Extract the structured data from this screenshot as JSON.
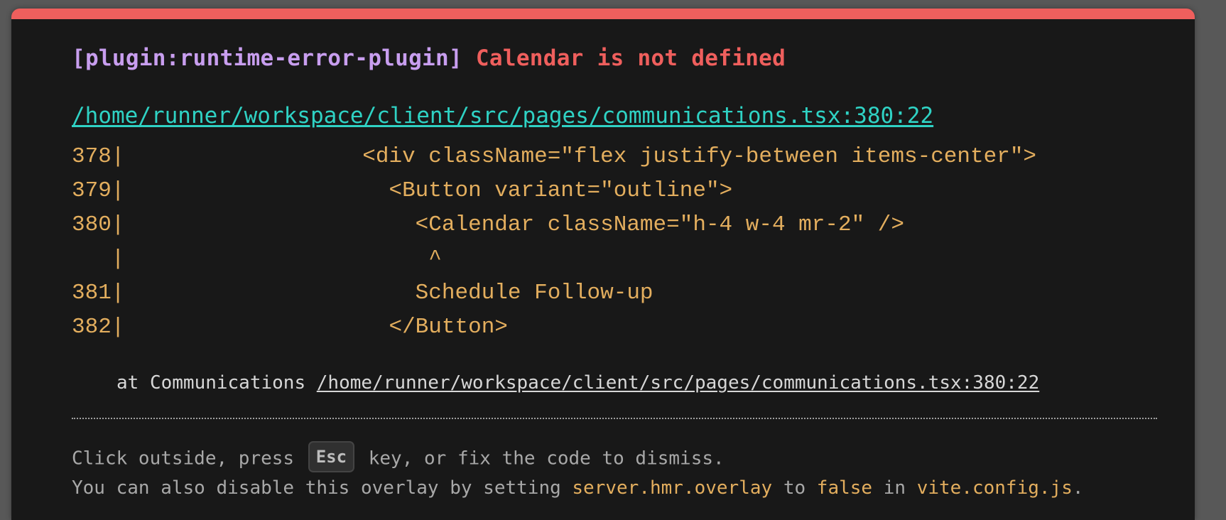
{
  "error": {
    "plugin": "[plugin:runtime-error-plugin]",
    "message": "Calendar is not defined"
  },
  "file_link": "/home/runner/workspace/client/src/pages/communications.tsx:380:22",
  "frame_lines": [
    "378|                  <div className=\"flex justify-between items-center\">",
    "379|                    <Button variant=\"outline\">",
    "380|                      <Calendar className=\"h-4 w-4 mr-2\" />",
    "   |                       ^",
    "381|                      Schedule Follow-up",
    "382|                    </Button>"
  ],
  "stack": {
    "prefix": "at Communications ",
    "link": "/home/runner/workspace/client/src/pages/communications.tsx:380:22"
  },
  "tip": {
    "line1_before": "Click outside, press ",
    "key": "Esc",
    "line1_after": " key, or fix the code to dismiss.",
    "line2_before": "You can also disable this overlay by setting ",
    "setting": "server.hmr.overlay",
    "to": " to ",
    "value": "false",
    "in": " in ",
    "config_file": "vite.config.js",
    "end": "."
  },
  "colors": {
    "accent_bar": "#ef5f5d",
    "plugin": "#c89eef",
    "error": "#ef5f5d",
    "link": "#2fd2c4",
    "code": "#e3ae5e",
    "background": "#181818"
  }
}
